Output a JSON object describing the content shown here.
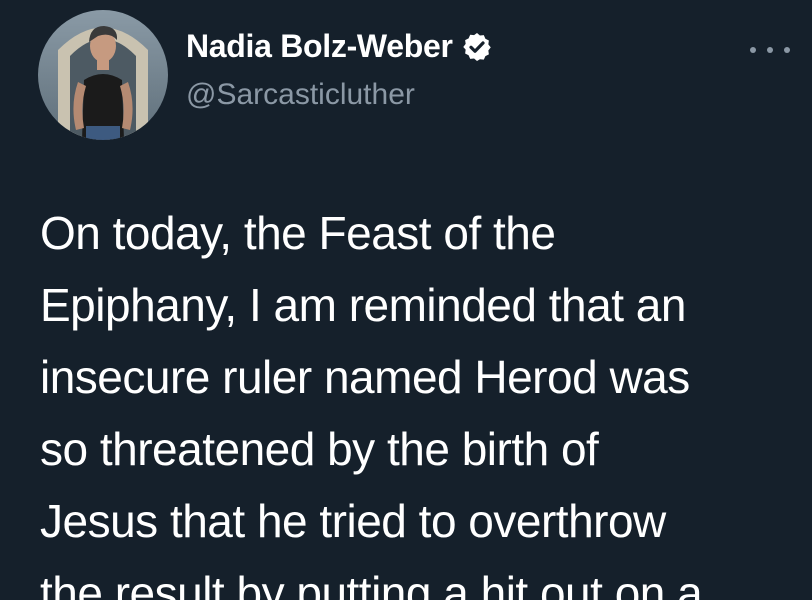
{
  "tweet": {
    "author_name": "Nadia Bolz-Weber",
    "handle": "@Sarcasticluther",
    "verified": true,
    "more_icon": "more-horizontal-icon",
    "body_lines": [
      "On today, the Feast of the",
      "Epiphany, I am reminded that an",
      "insecure ruler named Herod was",
      "so threatened by the birth of",
      "Jesus that he tried to overthrow",
      "the result by putting a hit out on a"
    ]
  },
  "colors": {
    "background": "#15202b",
    "text": "#ffffff",
    "secondary_text": "#8b98a5"
  }
}
